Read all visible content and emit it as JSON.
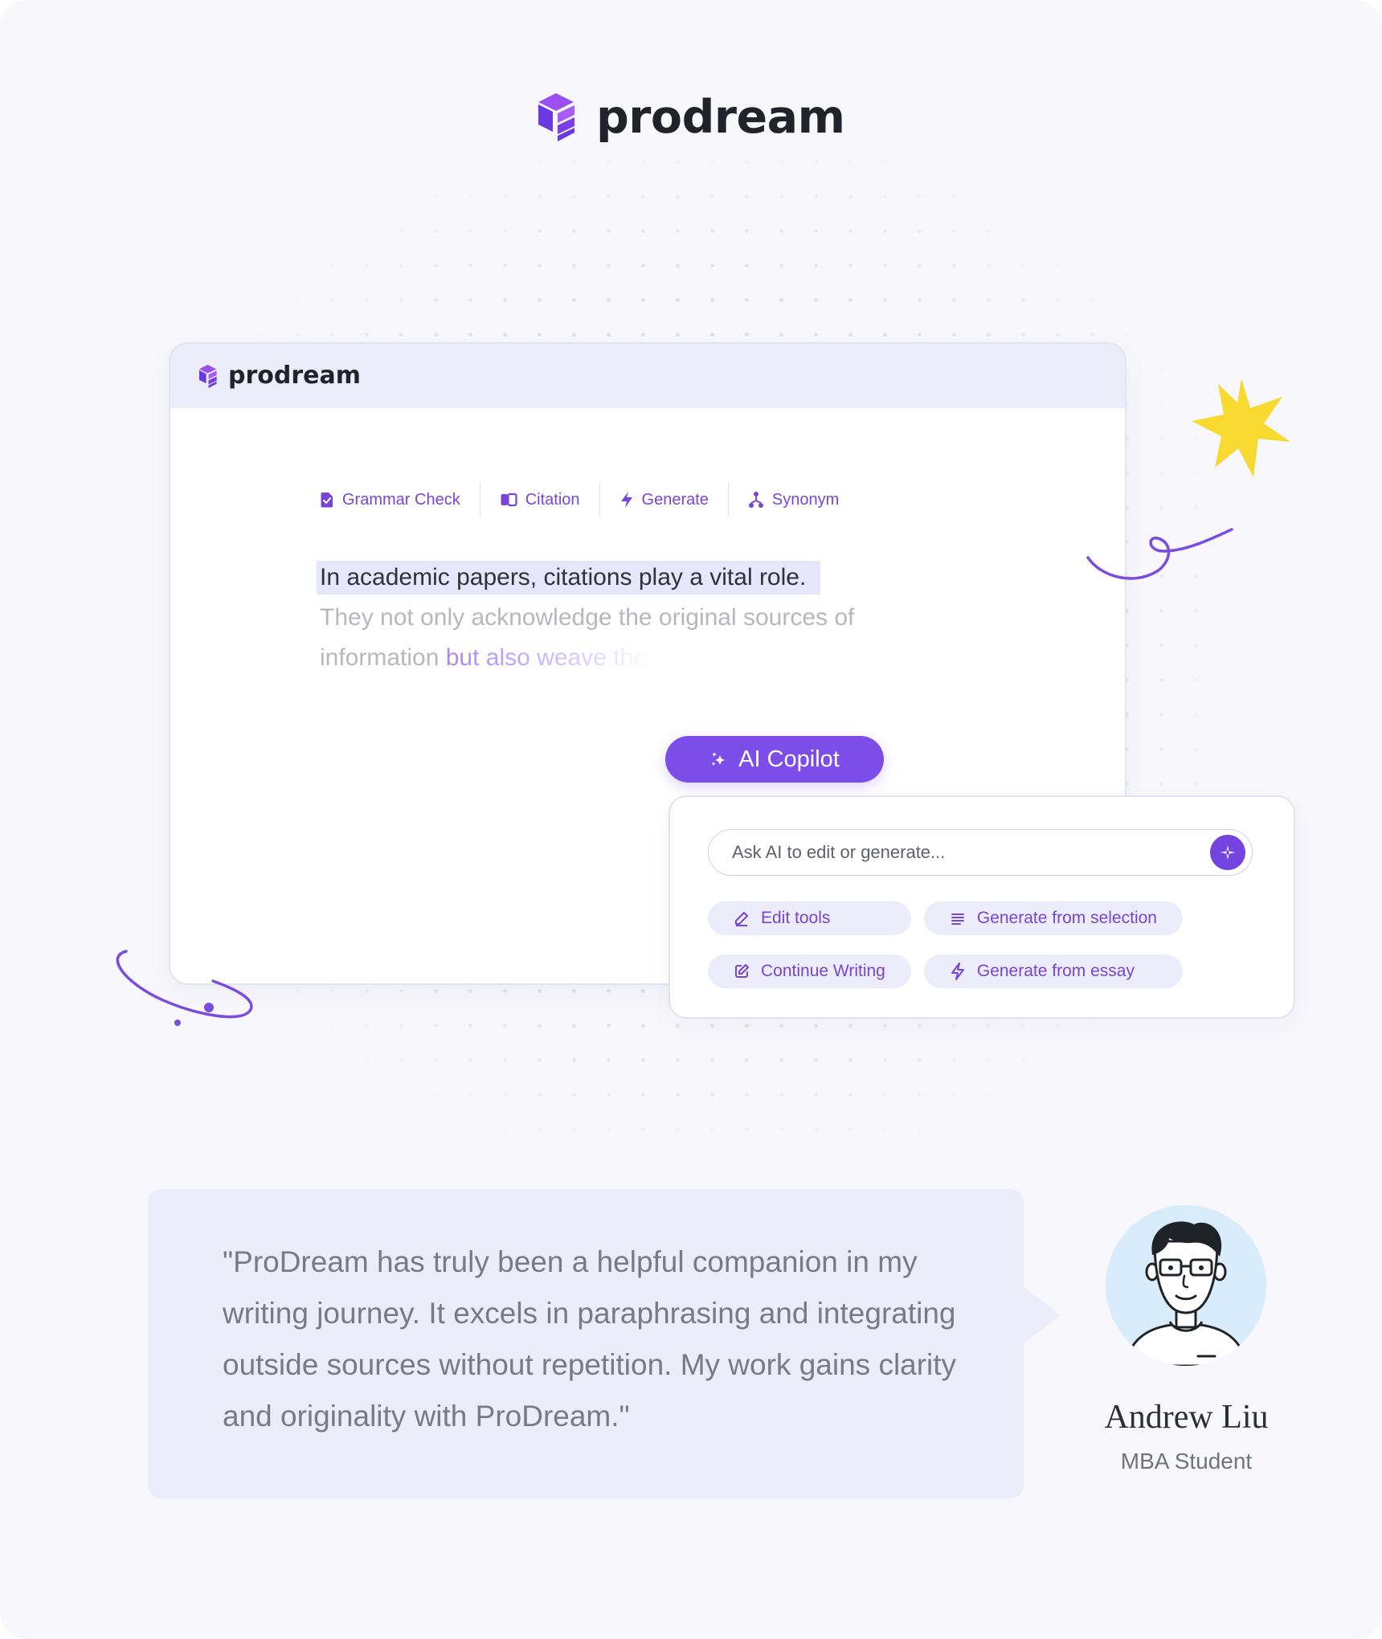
{
  "brand": {
    "name": "prodream",
    "icon": "prodream-logo-icon",
    "accent": "#7c4de8",
    "logo_colors": [
      "#9b4ff2",
      "#6b39df"
    ]
  },
  "editor": {
    "header_brand": "prodream",
    "toolbar": [
      {
        "label": "Grammar Check",
        "icon": "grammar-check-icon"
      },
      {
        "label": "Citation",
        "icon": "citation-icon"
      },
      {
        "label": "Generate",
        "icon": "generate-icon"
      },
      {
        "label": "Synonym",
        "icon": "synonym-icon"
      }
    ],
    "content": {
      "selected": "In academic papers, citations play a vital role.",
      "continued": "They not only acknowledge the original sources of information ",
      "generated": "but also weave the"
    }
  },
  "copilot": {
    "button_label": "AI Copilot",
    "button_icon": "sparkle-icon",
    "input_placeholder": "Ask AI to edit or generate...",
    "submit_icon": "sparkle-submit-icon",
    "actions": [
      {
        "label": "Edit tools",
        "icon": "pencil-icon"
      },
      {
        "label": "Generate from selection",
        "icon": "list-icon"
      },
      {
        "label": "Continue Writing",
        "icon": "edit-square-icon"
      },
      {
        "label": "Generate from essay",
        "icon": "lightning-icon"
      }
    ]
  },
  "testimonial": {
    "quote": "\"ProDream has truly been a helpful companion in my writing journey. It excels in paraphrasing and integrating outside sources without repetition. My work gains clarity and originality with ProDream.\"",
    "name": "Andrew Liu",
    "role": "MBA Student",
    "avatar_icon": "avatar-icon"
  },
  "decorations": {
    "star_icon": "star-icon",
    "star_color": "#f8d92f",
    "squiggle_icon": "squiggle-icon",
    "orbit_icon": "orbit-icon"
  }
}
